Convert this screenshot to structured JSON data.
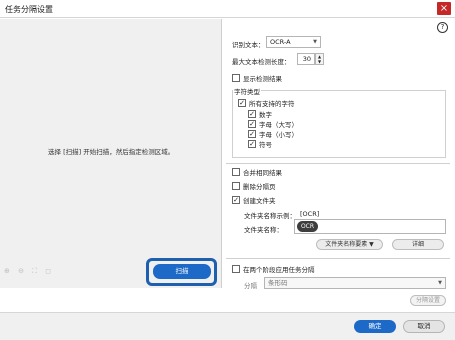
{
  "window": {
    "title": "任务分隔设置",
    "close_glyph": "×"
  },
  "preview": {
    "instruction": "选择 [扫描] 开始扫描，然后指定检测区域。",
    "tool_icons": "⊕ ⊖ ⛶ ◻",
    "scan_button": "扫描"
  },
  "settings": {
    "help_glyph": "?",
    "recognition_label": "识别文本：",
    "recognition_value": "OCR-A",
    "max_length_label": "最大文本检测长度：",
    "max_length_value": "30",
    "show_results_label": "显示检测结果",
    "char_type_title": "字符类型",
    "all_supported_label": "所有支持的字符",
    "char_types": [
      "数字",
      "字母（大写）",
      "字母（小写）",
      "符号"
    ],
    "merge_results_label": "合并相同结果",
    "delete_separator_label": "删除分隔页",
    "create_folder_label": "创建文件夹",
    "folder_example_label": "文件夹名称示例：",
    "folder_example_value": "[OCR]",
    "folder_name_label": "文件夹名称：",
    "folder_name_token": "OCR",
    "folder_elements_button": "文件夹名称要素 ▼",
    "details_button": "详细",
    "two_stage_label": "在两个阶段应用任务分隔",
    "separator_label": "分隔",
    "separator_value": "条形码",
    "separator_settings_button": "分隔设置"
  },
  "footer": {
    "ok_button": "确定",
    "cancel_button": "取消"
  },
  "colors": {
    "accent": "#1c69c8",
    "highlight_border": "#1e5fae",
    "close": "#c62828"
  }
}
